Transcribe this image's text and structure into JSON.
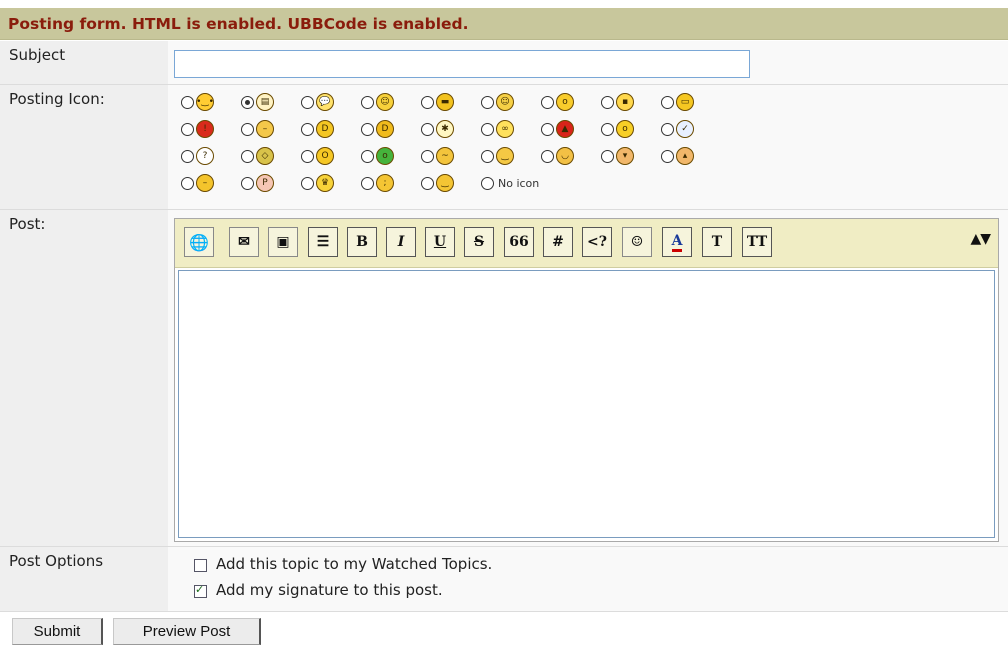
{
  "header": {
    "title": "Posting form. HTML is enabled. UBBCode is enabled."
  },
  "subject": {
    "label": "Subject",
    "value": ""
  },
  "posting_icon": {
    "label": "Posting Icon:",
    "rows": [
      [
        {
          "name": "smile-face-icon",
          "bg": "#ffcc33",
          "glyph": "•‿•"
        },
        {
          "name": "document-icon",
          "bg": "#fff3c4",
          "glyph": "▤",
          "selected": true
        },
        {
          "name": "speech-bubble-icon",
          "bg": "#ffe26b",
          "glyph": "💬"
        },
        {
          "name": "silly-face-icon",
          "bg": "#f7d13b",
          "glyph": "☺"
        },
        {
          "name": "cool-face-icon",
          "bg": "#f2c21f",
          "glyph": "▬"
        },
        {
          "name": "happy-face-icon",
          "bg": "#f6d046",
          "glyph": "☺"
        },
        {
          "name": "shocked-face-icon",
          "bg": "#f8cc2c",
          "glyph": "o"
        },
        {
          "name": "floppy-disk-icon",
          "bg": "#ffd84d",
          "glyph": "▪"
        },
        {
          "name": "grinning-face-icon",
          "bg": "#f5c722",
          "glyph": "▭"
        }
      ],
      [
        {
          "name": "alert-face-icon",
          "bg": "#d92b1c",
          "glyph": "!"
        },
        {
          "name": "unsure-face-icon",
          "bg": "#f4c84a",
          "glyph": "–"
        },
        {
          "name": "big-grin-face-icon",
          "bg": "#f4c623",
          "glyph": "D"
        },
        {
          "name": "laughing-face-icon",
          "bg": "#f0bb1d",
          "glyph": "D"
        },
        {
          "name": "lightbulb-icon",
          "bg": "#fff7c2",
          "glyph": "✱"
        },
        {
          "name": "chain-link-icon",
          "bg": "#ffe15c",
          "glyph": "∞"
        },
        {
          "name": "angry-face-icon",
          "bg": "#d9241a",
          "glyph": "▲"
        },
        {
          "name": "surprised-face-icon",
          "bg": "#f7cf26",
          "glyph": "o"
        },
        {
          "name": "checklist-icon",
          "bg": "#e8f0ff",
          "glyph": "✓"
        }
      ],
      [
        {
          "name": "question-mark-icon",
          "bg": "#ffffff",
          "glyph": "?"
        },
        {
          "name": "alien-icon",
          "bg": "#d8c24a",
          "glyph": "◇"
        },
        {
          "name": "wide-eyes-face-icon",
          "bg": "#f5c725",
          "glyph": "O"
        },
        {
          "name": "sick-face-icon",
          "bg": "#45b33c",
          "glyph": "o"
        },
        {
          "name": "confused-face-icon",
          "bg": "#f3c43c",
          "glyph": "~"
        },
        {
          "name": "content-face-icon",
          "bg": "#f4c844",
          "glyph": "‿"
        },
        {
          "name": "blushing-face-icon",
          "bg": "#f2c045",
          "glyph": "◡"
        },
        {
          "name": "thumbs-down-icon",
          "bg": "#f1b76a",
          "glyph": "▾"
        },
        {
          "name": "thumbs-up-icon",
          "bg": "#f1b76a",
          "glyph": "▴"
        }
      ],
      [
        {
          "name": "mad-face-icon",
          "bg": "#f4c42c",
          "glyph": "–"
        },
        {
          "name": "tongue-face-icon",
          "bg": "#f6c6b4",
          "glyph": "P"
        },
        {
          "name": "trophy-icon",
          "bg": "#f7d33a",
          "glyph": "♛"
        },
        {
          "name": "winking-face-icon",
          "bg": "#f4c534",
          "glyph": ";"
        },
        {
          "name": "smirk-face-icon",
          "bg": "#f4c534",
          "glyph": "‿"
        },
        {
          "name": "no-icon",
          "no_icon": true,
          "label": "No icon"
        }
      ]
    ]
  },
  "post": {
    "label": "Post:",
    "toolbar": [
      {
        "name": "insert-link-button",
        "icon": "globe-icon",
        "glyph": "🌐",
        "kind": "img"
      },
      {
        "name": "insert-email-button",
        "icon": "envelope-icon",
        "glyph": "✉",
        "kind": "img"
      },
      {
        "name": "insert-image-button",
        "icon": "image-icon",
        "glyph": "▣",
        "kind": "img"
      },
      {
        "name": "insert-list-button",
        "icon": "list-icon",
        "glyph": "☰",
        "kind": "txt"
      },
      {
        "name": "bold-button",
        "glyph": "B",
        "kind": "txt"
      },
      {
        "name": "italic-button",
        "glyph": "I",
        "kind": "txt"
      },
      {
        "name": "underline-button",
        "glyph": "U",
        "kind": "txt"
      },
      {
        "name": "strikethrough-button",
        "glyph": "S",
        "kind": "txt"
      },
      {
        "name": "quote-button",
        "glyph": "66",
        "kind": "txt"
      },
      {
        "name": "code-button",
        "glyph": "#",
        "kind": "txt"
      },
      {
        "name": "php-code-button",
        "glyph": "<?",
        "kind": "txt"
      },
      {
        "name": "smilies-button",
        "icon": "smiley-icon",
        "glyph": "☺",
        "kind": "img"
      },
      {
        "name": "text-color-button",
        "icon": "text-color-icon",
        "glyph": "A",
        "kind": "txt"
      },
      {
        "name": "font-button",
        "icon": "font-icon",
        "glyph": "T",
        "kind": "txt"
      },
      {
        "name": "font-size-button",
        "icon": "font-size-icon",
        "glyph": "TT",
        "kind": "txt"
      }
    ],
    "resize_icons": "▲▼",
    "body": ""
  },
  "options": {
    "label": "Post Options",
    "watch": {
      "label": "Add this topic to my Watched Topics.",
      "checked": false
    },
    "signature": {
      "label": "Add my signature to this post.",
      "checked": true
    }
  },
  "buttons": {
    "submit": "Submit",
    "preview": "Preview Post"
  }
}
